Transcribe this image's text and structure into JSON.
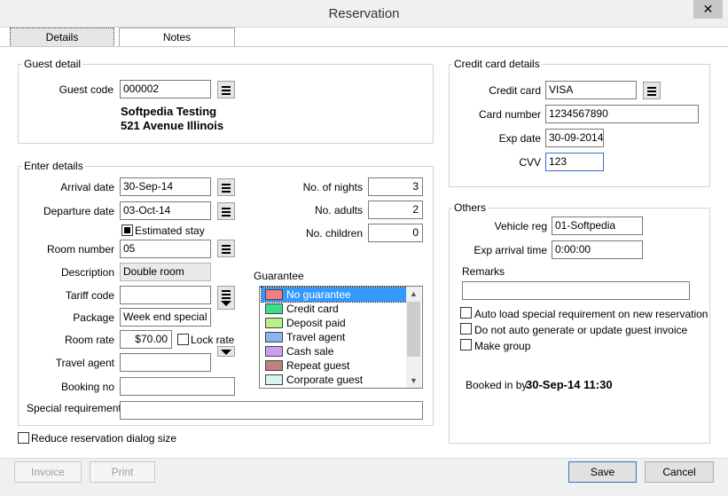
{
  "window": {
    "title": "Reservation",
    "close_glyph": "✕"
  },
  "tabs": [
    {
      "label": "Details"
    },
    {
      "label": "Notes"
    }
  ],
  "guest": {
    "group_label": "Guest detail",
    "code_label": "Guest code",
    "code_value": "000002",
    "name": "Softpedia Testing",
    "address": "521 Avenue Illinois"
  },
  "enter": {
    "group_label": "Enter details",
    "arrival_label": "Arrival date",
    "arrival_value": "30-Sep-14",
    "departure_label": "Departure date",
    "departure_value": "03-Oct-14",
    "estimated_label": "Estimated stay",
    "estimated_checked": true,
    "room_label": "Room number",
    "room_value": "05",
    "description_label": "Description",
    "description_value": "Double room",
    "tariff_label": "Tariff code",
    "tariff_value": "",
    "package_label": "Package",
    "package_value": "Week end special",
    "rate_label": "Room rate",
    "rate_value": "$70.00",
    "lock_label": "Lock rate",
    "agent_label": "Travel agent",
    "agent_value": "",
    "booking_label": "Booking no",
    "booking_value": "",
    "special_label": "Special requirements",
    "special_value": "",
    "nights_label": "No. of nights",
    "nights_value": "3",
    "adults_label": "No. adults",
    "adults_value": "2",
    "children_label": "No. children",
    "children_value": "0",
    "guarantee_label": "Guarantee",
    "guarantee_options": [
      {
        "label": "No guarantee",
        "color": "#f08080",
        "selected": true
      },
      {
        "label": "Credit card",
        "color": "#3cdc8c"
      },
      {
        "label": "Deposit paid",
        "color": "#b4f08c"
      },
      {
        "label": "Travel agent",
        "color": "#8cb4f0"
      },
      {
        "label": "Cash sale",
        "color": "#c8a0f0"
      },
      {
        "label": "Repeat guest",
        "color": "#c08080"
      },
      {
        "label": "Corporate guest",
        "color": "#d8f4ec"
      }
    ]
  },
  "card": {
    "group_label": "Credit card details",
    "card_label": "Credit card",
    "card_value": "VISA",
    "number_label": "Card number",
    "number_value": "1234567890",
    "exp_label": "Exp date",
    "exp_value": "30-09-2014",
    "cvv_label": "CVV",
    "cvv_value": "123"
  },
  "others": {
    "group_label": "Others",
    "vehicle_label": "Vehicle reg",
    "vehicle_value": "01-Softpedia",
    "arrival_time_label": "Exp arrival time",
    "arrival_time_value": "0:00:00",
    "remarks_label": "Remarks",
    "remarks_value": "",
    "autoload_label": "Auto load special requirement on new reservation",
    "noinvoice_label": "Do not auto generate or update guest invoice",
    "makegroup_label": "Make group",
    "booked_label": "Booked in by",
    "booked_value": "30-Sep-14 11:30"
  },
  "reduce_label": "Reduce reservation dialog size",
  "buttons": {
    "invoice": "Invoice",
    "print": "Print",
    "save": "Save",
    "cancel": "Cancel"
  }
}
